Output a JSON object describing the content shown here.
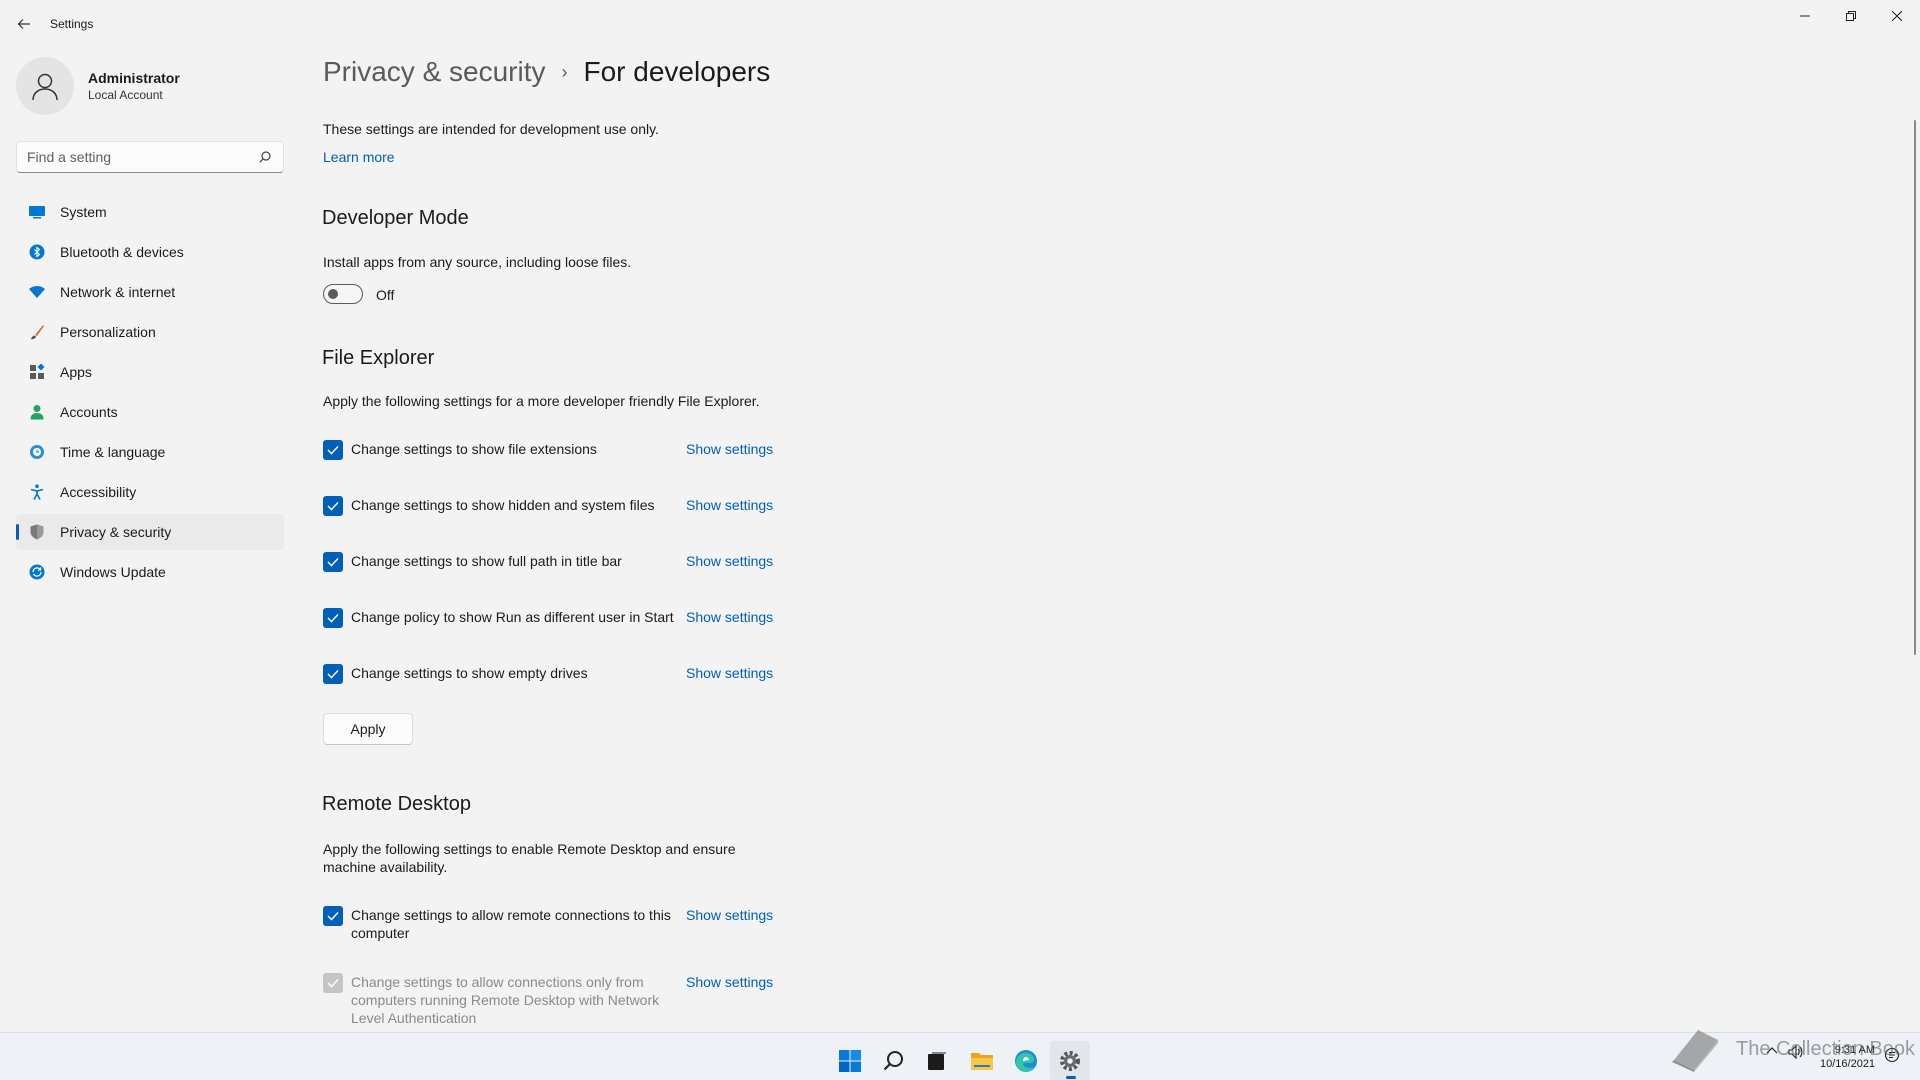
{
  "window": {
    "title": "Settings"
  },
  "user": {
    "name": "Administrator",
    "account_type": "Local Account"
  },
  "search": {
    "placeholder": "Find a setting"
  },
  "sidebar": {
    "items": [
      {
        "label": "System",
        "icon": "system-icon"
      },
      {
        "label": "Bluetooth & devices",
        "icon": "bluetooth-icon"
      },
      {
        "label": "Network & internet",
        "icon": "network-icon"
      },
      {
        "label": "Personalization",
        "icon": "brush-icon"
      },
      {
        "label": "Apps",
        "icon": "apps-icon"
      },
      {
        "label": "Accounts",
        "icon": "accounts-icon"
      },
      {
        "label": "Time & language",
        "icon": "time-language-icon"
      },
      {
        "label": "Accessibility",
        "icon": "accessibility-icon"
      },
      {
        "label": "Privacy & security",
        "icon": "shield-icon",
        "active": true
      },
      {
        "label": "Windows Update",
        "icon": "update-icon"
      }
    ]
  },
  "breadcrumb": {
    "parent": "Privacy & security",
    "separator": "›",
    "current": "For developers"
  },
  "intro": {
    "text": "These settings are intended for development use only.",
    "learn_more": "Learn more"
  },
  "developer_mode": {
    "title": "Developer Mode",
    "description": "Install apps from any source, including loose files.",
    "toggle_state": "Off"
  },
  "file_explorer": {
    "title": "File Explorer",
    "description": "Apply the following settings for a more developer friendly File Explorer.",
    "options": [
      {
        "label": "Change settings to show file extensions",
        "link": "Show settings",
        "checked": true
      },
      {
        "label": "Change settings to show hidden and system files",
        "link": "Show settings",
        "checked": true
      },
      {
        "label": "Change settings to show full path in title bar",
        "link": "Show settings",
        "checked": true
      },
      {
        "label": "Change policy to show Run as different user in Start",
        "link": "Show settings",
        "checked": true
      },
      {
        "label": "Change settings to show empty drives",
        "link": "Show settings",
        "checked": true
      }
    ],
    "apply_label": "Apply"
  },
  "remote_desktop": {
    "title": "Remote Desktop",
    "description": "Apply the following settings to enable Remote Desktop and ensure machine availability.",
    "options": [
      {
        "label": "Change settings to allow remote connections to this computer",
        "link": "Show settings",
        "checked": true,
        "disabled": false
      },
      {
        "label": "Change settings to allow connections only from computers running Remote Desktop with Network Level Authentication",
        "link": "Show settings",
        "checked": true,
        "disabled": true
      }
    ]
  },
  "taskbar": {
    "apps": [
      "start-icon",
      "search-icon",
      "task-view-icon",
      "file-explorer-icon",
      "edge-icon",
      "settings-icon"
    ],
    "active_app": "settings-icon",
    "watermark": "The Collection Book",
    "time": "9:31 AM",
    "date": "10/16/2021"
  },
  "colors": {
    "accent": "#005fb8",
    "background": "#f3f3f3",
    "taskbar": "#eef1f6"
  }
}
